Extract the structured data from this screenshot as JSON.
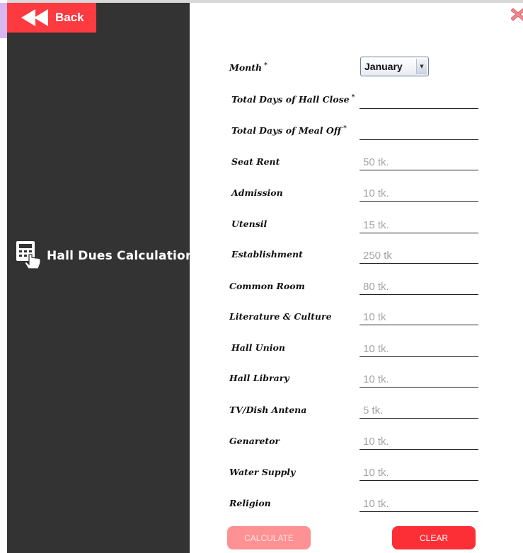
{
  "back_label": "Back",
  "title": "Hall Dues Calculation",
  "month": {
    "label": "Month",
    "selected": "January"
  },
  "hall_close": {
    "label": "Total Days of Hall Close",
    "value": ""
  },
  "meal_off": {
    "label": "Total Days of Meal Off",
    "value": ""
  },
  "fees": [
    {
      "label": "Seat Rent",
      "value": "50 tk."
    },
    {
      "label": "Admission",
      "value": "10 tk."
    },
    {
      "label": "Utensil",
      "value": "15 tk."
    },
    {
      "label": "Establishment",
      "value": "250 tk"
    },
    {
      "label": "Common Room",
      "value": "80 tk."
    },
    {
      "label": "Literature & Culture",
      "value": "10 tk"
    },
    {
      "label": "Hall Union",
      "value": "10 tk."
    },
    {
      "label": "Hall Library",
      "value": "10 tk."
    },
    {
      "label": "TV/Dish Antena",
      "value": "5 tk."
    },
    {
      "label": "Genaretor",
      "value": "10 tk."
    },
    {
      "label": "Water Supply",
      "value": "10 tk."
    },
    {
      "label": "Religion",
      "value": "10 tk."
    }
  ],
  "buttons": {
    "calculate": "CALCULATE",
    "clear": "CLEAR"
  },
  "required_marker": "*",
  "icons": {
    "back": "rewind-icon",
    "title": "calculator-touch-icon",
    "close": "close-icon"
  },
  "colors": {
    "sidebar": "#333333",
    "accent": "#fc3a3f",
    "calculate_disabled": "#fd9193"
  }
}
